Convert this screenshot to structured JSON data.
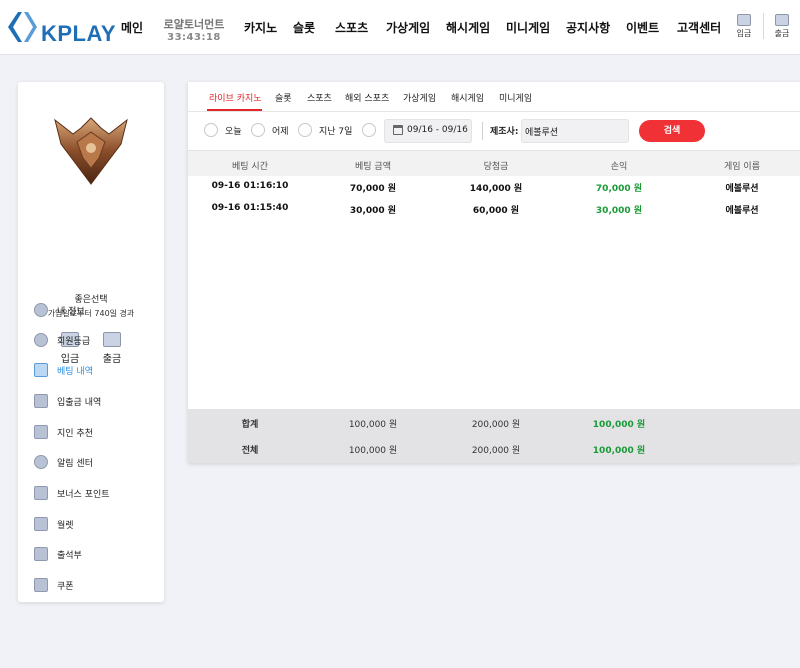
{
  "header": {
    "logo_text": "KPLAY",
    "nav": [
      "메인",
      "카지노",
      "슬롯",
      "스포츠",
      "가상게임",
      "해시게임",
      "미니게임",
      "공지사항",
      "이벤트",
      "고객센터"
    ],
    "royal_tournament": "로얄토너먼트",
    "countdown": "33:43:18",
    "deposit_label": "입금",
    "withdraw_label": "출금"
  },
  "sidebar": {
    "user_name": "좋은선택",
    "join_days": "가입일로부터 740일 경과",
    "deposit_label": "입금",
    "withdraw_label": "출금",
    "menu": [
      "내 정보",
      "회원등급",
      "베팅 내역",
      "입출금 내역",
      "지인 추천",
      "알림 센터",
      "보너스 포인트",
      "월렛",
      "출석부",
      "쿠폰"
    ],
    "active_index": 2
  },
  "tabs": [
    "라이브 카지노",
    "슬롯",
    "스포츠",
    "해외 스포츠",
    "가상게임",
    "해시게임",
    "미니게임"
  ],
  "filters": {
    "today": "오늘",
    "yesterday": "어제",
    "last7": "지난 7일",
    "date_range": "09/16 - 09/16",
    "maker_label": "제조사:",
    "maker_value": "에볼루션",
    "search_label": "검색"
  },
  "table": {
    "headers": [
      "베팅 시간",
      "베팅 금액",
      "당첨금",
      "손익",
      "게임 이름"
    ],
    "rows": [
      [
        "09-16 01:16:10",
        "70,000 원",
        "140,000 원",
        "70,000 원",
        "에볼루션"
      ],
      [
        "09-16 01:15:40",
        "30,000 원",
        "60,000 원",
        "30,000 원",
        "에볼루션"
      ]
    ],
    "summary": [
      [
        "합계",
        "100,000 원",
        "200,000 원",
        "100,000 원"
      ],
      [
        "전체",
        "100,000 원",
        "200,000 원",
        "100,000 원"
      ]
    ]
  },
  "colors": {
    "accent": "#e0272a",
    "brand": "#1f6fb6",
    "profit": "#1a9a37",
    "active_menu": "#2a8ee0"
  }
}
